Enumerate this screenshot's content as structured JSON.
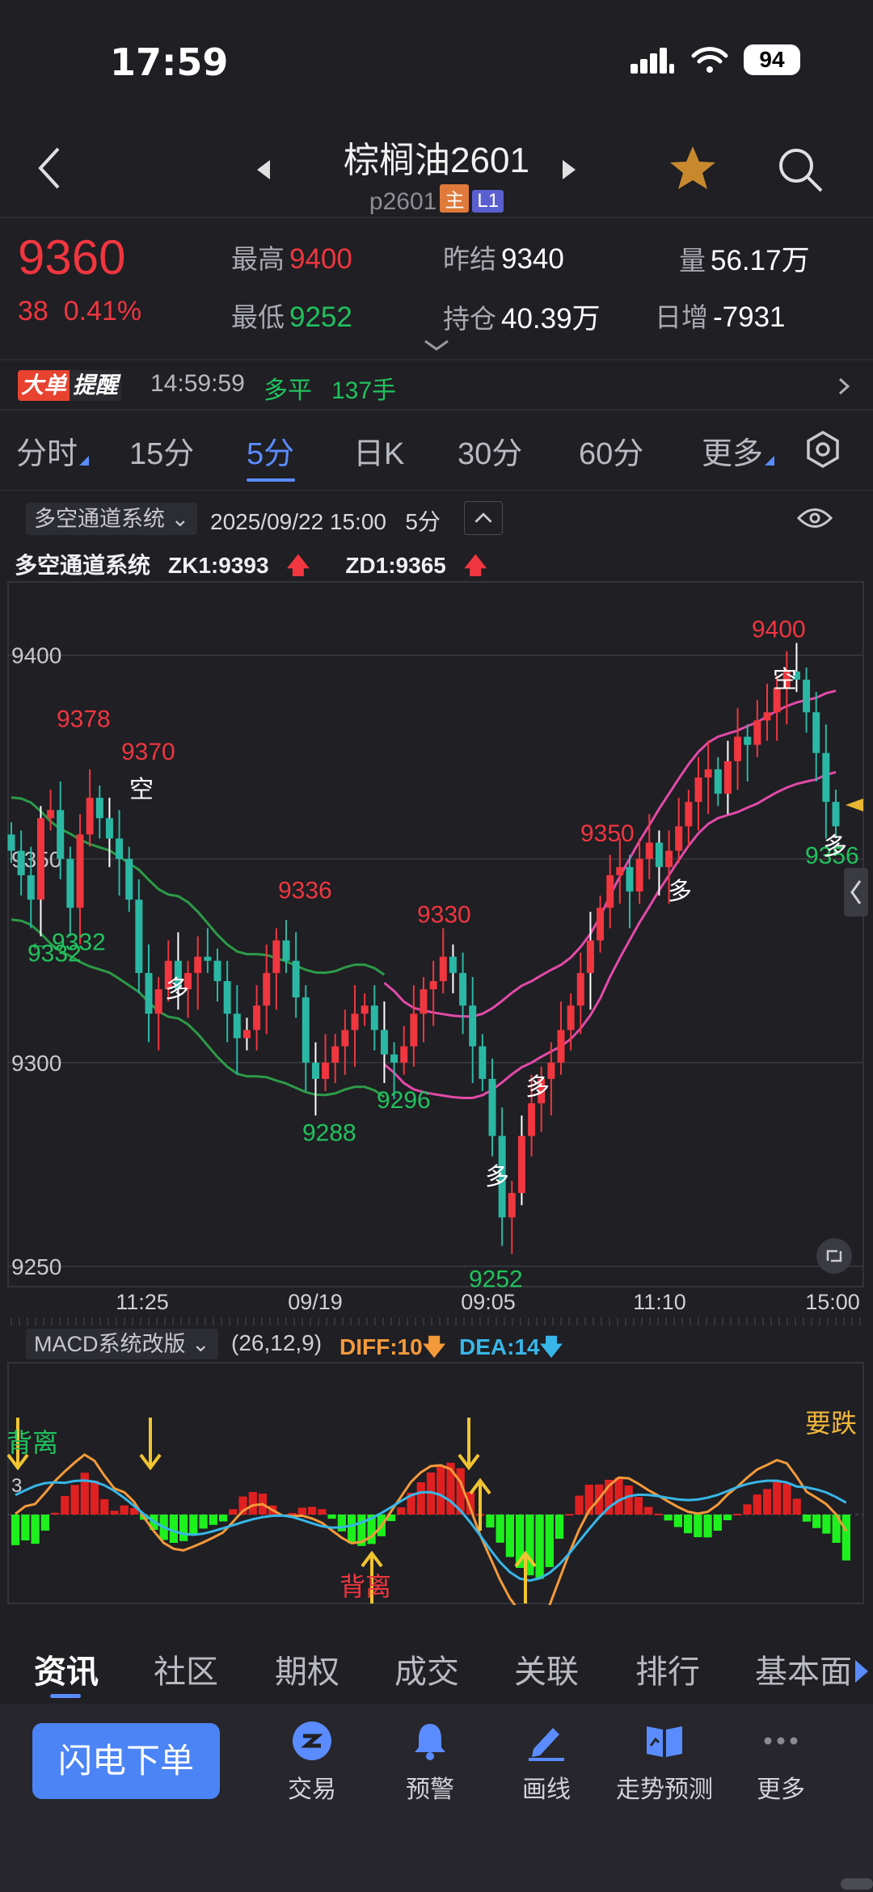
{
  "status_bar": {
    "time": "17:59",
    "battery": "94"
  },
  "header": {
    "title": "棕榈油2601",
    "code": "p2601",
    "tag_main": "主",
    "tag_level": "L1"
  },
  "quote": {
    "last_price": "9360",
    "change": "38",
    "change_pct": "0.41%",
    "high_label": "最高",
    "high": "9400",
    "low_label": "最低",
    "low": "9252",
    "prev_settle_label": "昨结",
    "prev_settle": "9340",
    "open_interest_label": "持仓",
    "open_interest": "40.39万",
    "volume_label": "量",
    "volume": "56.17万",
    "daily_change_label": "日增",
    "daily_change": "-7931"
  },
  "alert": {
    "badge_a": "大单",
    "badge_b": "提醒",
    "time": "14:59:59",
    "type": "多平",
    "volume": "137手"
  },
  "period_tabs": [
    {
      "label": "分时"
    },
    {
      "label": "15分"
    },
    {
      "label": "5分"
    },
    {
      "label": "日K"
    },
    {
      "label": "30分"
    },
    {
      "label": "60分"
    },
    {
      "label": "更多"
    }
  ],
  "chart_toolbar": {
    "indicator": "多空通道系统",
    "datetime": "2025/09/22 15:00",
    "period": "5分"
  },
  "indicator_values": {
    "name": "多空通道系统",
    "zk1": "ZK1:9393",
    "zd1": "ZD1:9365"
  },
  "chart_data": {
    "type": "candlestick",
    "y_ticks": [
      "9400",
      "9350",
      "9300",
      "9250"
    ],
    "ylim": [
      9245,
      9418
    ],
    "x_ticks": [
      "11:25",
      "09/19",
      "09:05",
      "11:10",
      "15:00"
    ],
    "price_labels": [
      "9378",
      "9370",
      "9336",
      "9330",
      "9350",
      "9400",
      "9356",
      "9332",
      "9288",
      "9296",
      "9252"
    ],
    "prev_close_marker": "←9332",
    "signals": [
      "空",
      "多",
      "多",
      "多",
      "多",
      "空",
      "多"
    ],
    "closes": [
      9352,
      9346,
      9340,
      9360,
      9362,
      9350,
      9338,
      9356,
      9365,
      9360,
      9355,
      9350,
      9340,
      9322,
      9312,
      9318,
      9325,
      9318,
      9322,
      9326,
      9325,
      9320,
      9312,
      9306,
      9308,
      9314,
      9322,
      9330,
      9325,
      9316,
      9300,
      9296,
      9300,
      9304,
      9308,
      9312,
      9314,
      9308,
      9302,
      9300,
      9304,
      9312,
      9318,
      9320,
      9326,
      9322,
      9314,
      9304,
      9296,
      9282,
      9262,
      9268,
      9282,
      9290,
      9296,
      9300,
      9308,
      9314,
      9322,
      9330,
      9338,
      9346,
      9348,
      9342,
      9350,
      9354,
      9348,
      9352,
      9358,
      9364,
      9370,
      9372,
      9366,
      9374,
      9380,
      9378,
      9384,
      9386,
      9392,
      9396,
      9394,
      9386,
      9376,
      9364,
      9358
    ],
    "macd_labels": [
      "背离",
      "3",
      "背离",
      "要跌"
    ]
  },
  "macd": {
    "name": "MACD系统改版",
    "params": "(26,12,9)",
    "diff": "DIFF:10",
    "dea": "DEA:14"
  },
  "info_tabs": [
    {
      "label": "资讯"
    },
    {
      "label": "社区"
    },
    {
      "label": "期权"
    },
    {
      "label": "成交"
    },
    {
      "label": "关联"
    },
    {
      "label": "排行"
    },
    {
      "label": "基本面"
    }
  ],
  "bottom_bar": {
    "flash_order": "闪电下单",
    "items": [
      {
        "label": "交易"
      },
      {
        "label": "预警"
      },
      {
        "label": "画线"
      },
      {
        "label": "走势预测"
      },
      {
        "label": "更多"
      }
    ]
  },
  "colors": {
    "up": "#f0363f",
    "down": "#21c25e",
    "accent": "#5b8cff",
    "channel_pink": "#e24aa8",
    "channel_green": "#2e9a48",
    "diff": "#f39a3a",
    "dea": "#38b6e8"
  }
}
